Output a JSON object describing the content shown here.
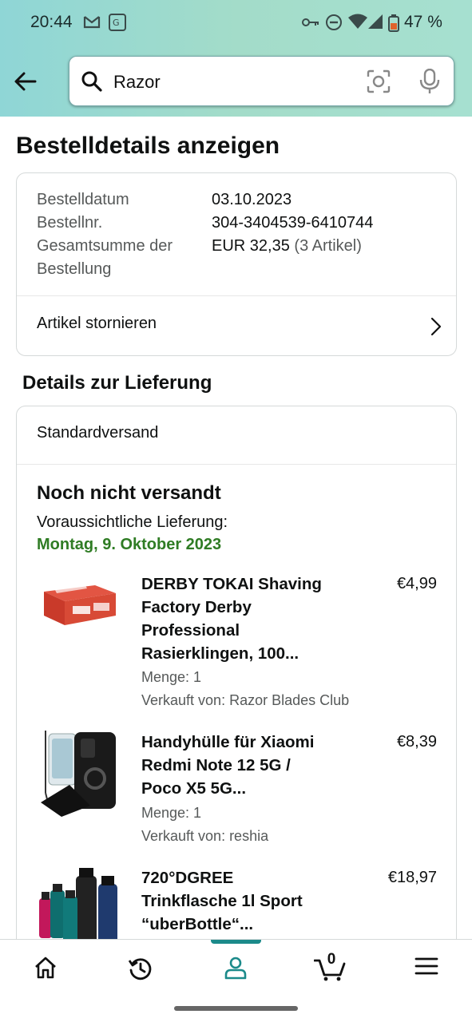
{
  "status_bar": {
    "time": "20:44",
    "battery": "47 %"
  },
  "search": {
    "query": "Razor"
  },
  "page": {
    "title": "Bestelldetails anzeigen"
  },
  "order_summary": {
    "date_label": "Bestelldatum",
    "date_value": "03.10.2023",
    "number_label": "Bestellnr.",
    "number_value": "304-3404539-6410744",
    "total_label_line1": "Gesamtsumme der",
    "total_label_line2": "Bestellung",
    "total_value": "EUR 32,35",
    "total_items": "(3 Artikel)",
    "cancel_label": "Artikel stornieren"
  },
  "delivery": {
    "section_title": "Details zur Lieferung",
    "method": "Standardversand",
    "status": "Noch nicht versandt",
    "eta_label": "Voraussichtliche Lieferung:",
    "eta_date": "Montag, 9. Oktober 2023"
  },
  "items": [
    {
      "title_lines": [
        "DERBY TOKAI Shaving",
        "Factory Derby",
        "Professional",
        "Rasierklingen, 100..."
      ],
      "price": "€4,99",
      "quantity": "Menge: 1",
      "seller": "Verkauft von: Razor Blades Club"
    },
    {
      "title_lines": [
        "Handyhülle für Xiaomi",
        "Redmi Note 12 5G /",
        "Poco X5 5G..."
      ],
      "price": "€8,39",
      "quantity": "Menge: 1",
      "seller": "Verkauft von: reshia"
    },
    {
      "title_lines": [
        "720°DGREE",
        "Trinkflasche 1l Sport",
        "“uberBottle“..."
      ],
      "price": "€18,97"
    }
  ],
  "bottom_nav": {
    "cart_count": "0"
  },
  "colors": {
    "accent": "#1b8a8a",
    "delivery_green": "#2f7c24",
    "header_gradient_start": "#8fd6d6"
  }
}
